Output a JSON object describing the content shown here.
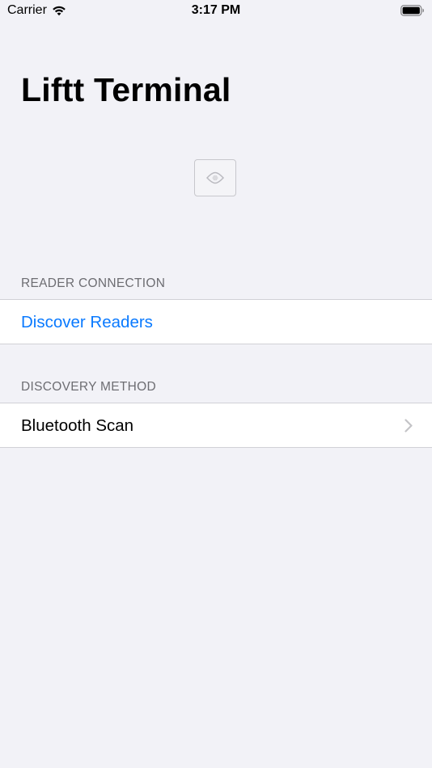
{
  "status_bar": {
    "carrier": "Carrier",
    "time": "3:17 PM",
    "icons": [
      "wifi-icon",
      "battery-icon"
    ]
  },
  "title": "Liftt Terminal",
  "reader_image": {
    "icon": "card-reader-icon"
  },
  "sections": [
    {
      "header": "READER CONNECTION",
      "rows": [
        {
          "label": "Discover Readers",
          "color": "#0a7aff"
        }
      ]
    },
    {
      "header": "DISCOVERY METHOD",
      "rows": [
        {
          "label": "Bluetooth Scan",
          "accessory": "chevron-right-icon"
        }
      ]
    }
  ],
  "colors": {
    "background": "#f2f2f7",
    "accent": "#0a7aff",
    "section_header": "#6d6d72"
  }
}
